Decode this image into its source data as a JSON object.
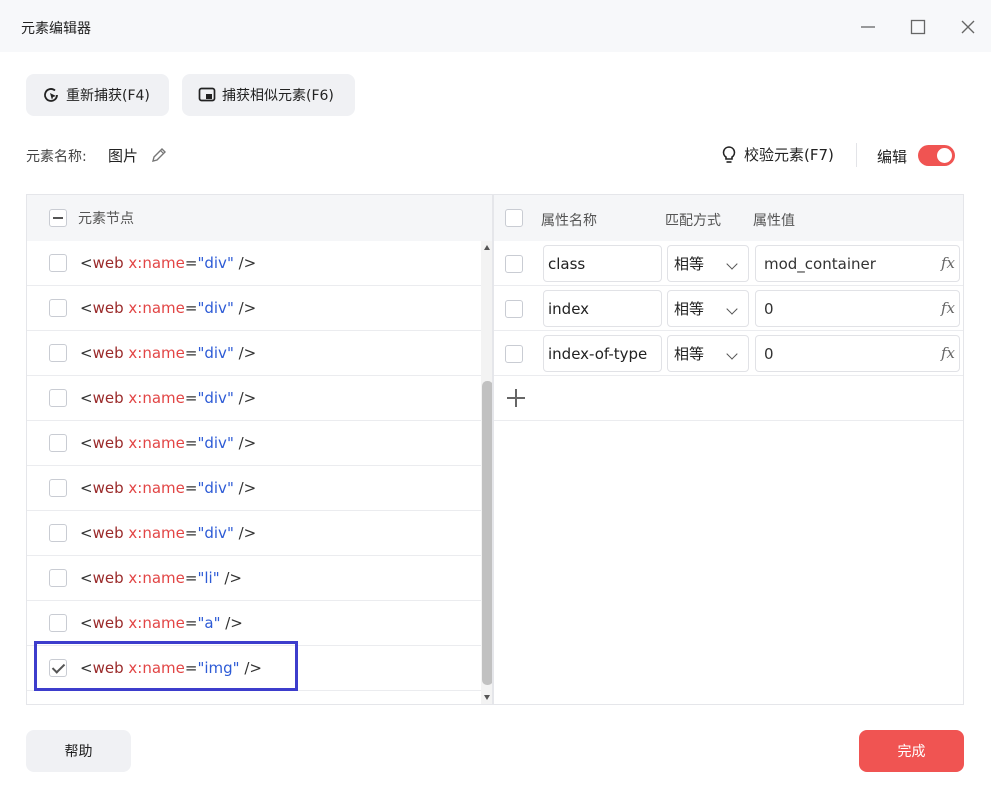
{
  "window": {
    "title": "元素编辑器"
  },
  "toolbar": {
    "recapture_label": "重新捕获(F4)",
    "capture_similar_label": "捕获相似元素(F6)"
  },
  "element_name": {
    "label": "元素名称:",
    "value": "图片"
  },
  "validate": {
    "label": "校验元素(F7)"
  },
  "edit_toggle": {
    "label": "编辑",
    "on": true,
    "color": "#f05452"
  },
  "nodes_panel": {
    "header": "元素节点",
    "rows": [
      {
        "tag": "web",
        "attr": "x:name",
        "value": "div",
        "checked": false
      },
      {
        "tag": "web",
        "attr": "x:name",
        "value": "div",
        "checked": false
      },
      {
        "tag": "web",
        "attr": "x:name",
        "value": "div",
        "checked": false
      },
      {
        "tag": "web",
        "attr": "x:name",
        "value": "div",
        "checked": false
      },
      {
        "tag": "web",
        "attr": "x:name",
        "value": "div",
        "checked": false
      },
      {
        "tag": "web",
        "attr": "x:name",
        "value": "div",
        "checked": false
      },
      {
        "tag": "web",
        "attr": "x:name",
        "value": "div",
        "checked": false
      },
      {
        "tag": "web",
        "attr": "x:name",
        "value": "li",
        "checked": false
      },
      {
        "tag": "web",
        "attr": "x:name",
        "value": "a",
        "checked": false
      },
      {
        "tag": "web",
        "attr": "x:name",
        "value": "img",
        "checked": true
      }
    ]
  },
  "attributes_panel": {
    "headers": {
      "name": "属性名称",
      "match": "匹配方式",
      "value": "属性值"
    },
    "rows": [
      {
        "name": "class",
        "match": "相等",
        "value": "mod_container",
        "checked": false
      },
      {
        "name": "index",
        "match": "相等",
        "value": "0",
        "checked": false
      },
      {
        "name": "index-of-type",
        "match": "相等",
        "value": "0",
        "checked": false
      }
    ],
    "fx_label": "fx"
  },
  "footer": {
    "help_label": "帮助",
    "done_label": "完成",
    "accent_color": "#f05452",
    "highlight_color": "#3d3dcc"
  }
}
